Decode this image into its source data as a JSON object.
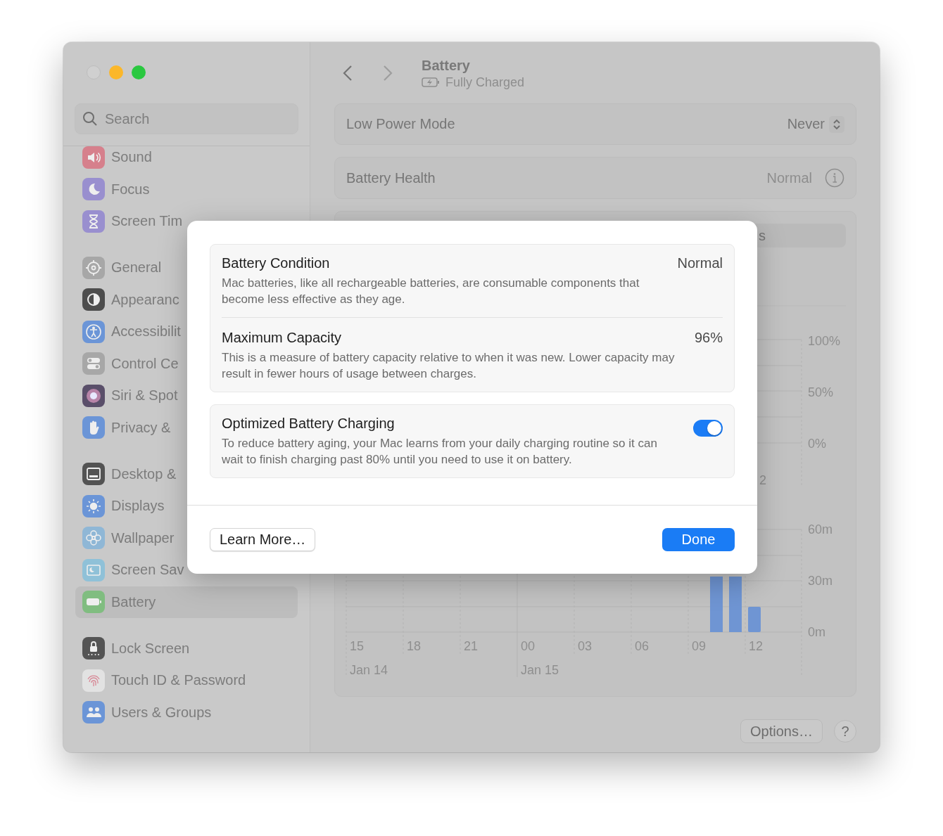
{
  "sidebar": {
    "search": {
      "placeholder": "Search"
    },
    "groups": [
      {
        "items": [
          {
            "label": "Sound",
            "selected": false
          },
          {
            "label": "Focus",
            "selected": false
          },
          {
            "label": "Screen Tim",
            "selected": false
          }
        ]
      },
      {
        "items": [
          {
            "label": "General",
            "selected": false
          },
          {
            "label": "Appearanc",
            "selected": false
          },
          {
            "label": "Accessibilit",
            "selected": false
          },
          {
            "label": "Control Ce",
            "selected": false
          },
          {
            "label": "Siri & Spot",
            "selected": false
          },
          {
            "label": "Privacy &",
            "selected": false
          }
        ]
      },
      {
        "items": [
          {
            "label": "Desktop &",
            "selected": false
          },
          {
            "label": "Displays",
            "selected": false
          },
          {
            "label": "Wallpaper",
            "selected": false
          },
          {
            "label": "Screen Sav",
            "selected": false
          },
          {
            "label": "Battery",
            "selected": true
          }
        ]
      },
      {
        "items": [
          {
            "label": "Lock Screen",
            "selected": false
          },
          {
            "label": "Touch ID & Password",
            "selected": false
          },
          {
            "label": "Users & Groups",
            "selected": false
          }
        ]
      }
    ]
  },
  "header": {
    "title": "Battery",
    "subtitle": "Fully Charged"
  },
  "settings": [
    {
      "kind": "popup",
      "label": "Low Power Mode",
      "value": "Never"
    },
    {
      "kind": "info",
      "label": "Battery Health",
      "value": "Normal"
    }
  ],
  "usage_panel": {
    "segment_fragment": "s",
    "upper_chart": {
      "y_labels": [
        "100%",
        "50%",
        "0%"
      ],
      "x_label_fragment": "2"
    },
    "lower_chart": {
      "y_labels": [
        "60m",
        "30m",
        "0m"
      ],
      "x_labels": [
        "15",
        "18",
        "21",
        "00",
        "03",
        "06",
        "09",
        "12"
      ],
      "date_labels": [
        "Jan 14",
        "Jan 15"
      ]
    }
  },
  "footer_buttons": [
    {
      "kind": "button",
      "label": "Options…"
    },
    {
      "kind": "help",
      "label": "?"
    }
  ],
  "dialog": {
    "groups": [
      {
        "rows": [
          {
            "kind": "value",
            "title": "Battery Condition",
            "value": "Normal",
            "description": "Mac batteries, like all rechargeable batteries, are consumable components that become less effective as they age."
          },
          {
            "kind": "value",
            "title": "Maximum Capacity",
            "value": "96%",
            "description": "This is a measure of battery capacity relative to when it was new. Lower capacity may result in fewer hours of usage between charges."
          }
        ]
      },
      {
        "rows": [
          {
            "kind": "toggle",
            "title": "Optimized Battery Charging",
            "on": true,
            "description": "To reduce battery aging, your Mac learns from your daily charging routine so it can wait to finish charging past 80% until you need to use it on battery."
          }
        ]
      }
    ],
    "buttons": [
      {
        "kind": "secondary",
        "label": "Learn More…"
      },
      {
        "kind": "primary",
        "label": "Done"
      }
    ]
  }
}
